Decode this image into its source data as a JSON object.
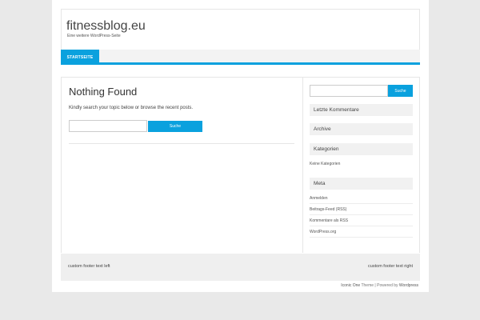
{
  "header": {
    "site_title": "fitnessblog.eu",
    "site_description": "Eine weitere WordPress-Seite"
  },
  "nav": {
    "items": [
      {
        "label": "STARTSEITE"
      }
    ]
  },
  "main": {
    "title": "Nothing Found",
    "text": "Kindly search your topic below or browse the recent posts.",
    "search": {
      "value": "",
      "button_label": "Suche"
    }
  },
  "sidebar": {
    "search": {
      "value": "",
      "button_label": "Suche"
    },
    "widgets": {
      "recent_comments": {
        "title": "Letzte Kommentare"
      },
      "archive": {
        "title": "Archive"
      },
      "categories": {
        "title": "Kategorien",
        "empty_text": "Keine Kategorien"
      },
      "meta": {
        "title": "Meta",
        "links": [
          "Anmelden",
          "Beitrags-Feed (RSS)",
          "Kommentare als RSS",
          "WordPress.org"
        ]
      }
    }
  },
  "footer": {
    "left_text": "custom footer text left",
    "right_text": "custom footer text right"
  },
  "credit": {
    "theme_link": "Iconic One",
    "theme_text": " Theme | Powered by ",
    "wp_link": "Wordpress"
  },
  "colors": {
    "accent": "#0aa1de",
    "page_background": "#e9e9e9",
    "widget_title_background": "#f1f1f1"
  }
}
